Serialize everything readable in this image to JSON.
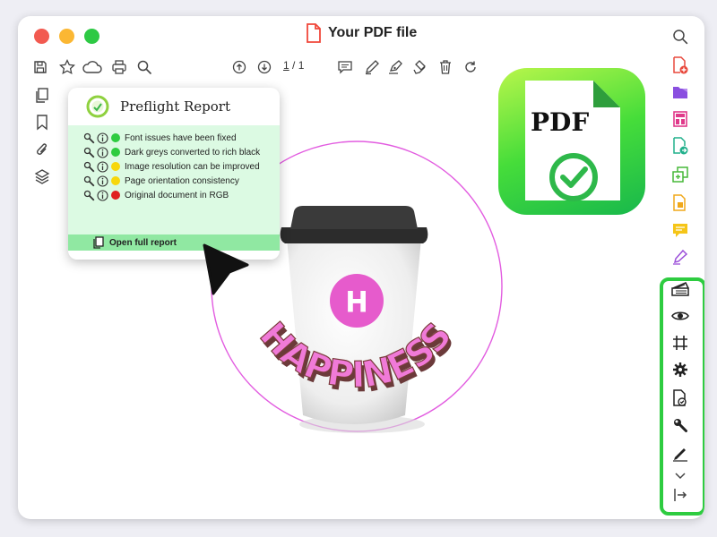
{
  "window": {
    "title": "Your PDF file",
    "traffic_lights": [
      "#f25a50",
      "#fbb733",
      "#2ec944"
    ]
  },
  "toolbar": {
    "page_current": "1",
    "page_separator": "/",
    "page_total": "1",
    "icons": [
      "save-icon",
      "star-icon",
      "cloud-icon",
      "print-icon",
      "search-icon",
      "arrow-up-circle-icon",
      "arrow-down-circle-icon",
      "comment-icon",
      "pen-icon",
      "highlighter-icon",
      "stamp-icon",
      "trash-icon",
      "refresh-icon"
    ]
  },
  "left_sidebar": {
    "icons": [
      "pages-icon",
      "bookmark-icon",
      "attachment-icon",
      "layers-icon"
    ]
  },
  "preflight": {
    "title": "Preflight Report",
    "items": [
      {
        "label": "Font issues have been fixed",
        "status_color": "#2ecc40"
      },
      {
        "label": "Dark greys converted to rich black",
        "status_color": "#2ecc40"
      },
      {
        "label": "Image resolution can be improved",
        "status_color": "#f7d70c"
      },
      {
        "label": "Page orientation consistency",
        "status_color": "#f7d70c"
      },
      {
        "label": "Original document in RGB",
        "status_color": "#e02020"
      }
    ],
    "footer_label": "Open full report"
  },
  "badge": {
    "label": "PDF"
  },
  "artwork": {
    "cup_logo_letter": "H",
    "word": "HAPPINESS",
    "ring_color": "#e25ce0",
    "text_color": "#f07ad8"
  },
  "right_sidebar": {
    "tools": [
      "search-icon",
      "add-pdf-icon",
      "folder-icon",
      "organize-pages-icon",
      "export-pdf-icon",
      "combine-files-icon",
      "edit-pdf-icon",
      "comment-icon",
      "fill-sign-icon"
    ],
    "green_panel_tools": [
      "swatch-book-icon",
      "eye-icon",
      "crop-marks-icon",
      "gear-icon",
      "checklist-icon",
      "wrench-icon",
      "pen-icon",
      "chevron-down-icon",
      "collapse-panel-icon"
    ],
    "accent_color": "#2ecc40"
  }
}
